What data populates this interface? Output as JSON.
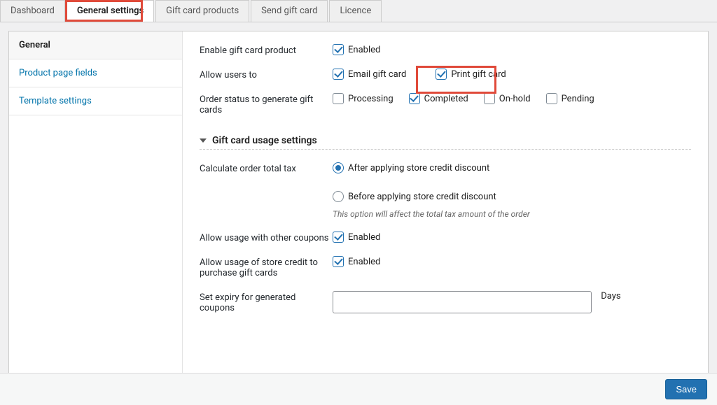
{
  "tabs": {
    "dashboard": "Dashboard",
    "general_settings": "General settings",
    "gift_card_products": "Gift card products",
    "send_gift_card": "Send gift card",
    "licence": "Licence"
  },
  "sidebar": {
    "general": "General",
    "product_page_fields": "Product page fields",
    "template_settings": "Template settings"
  },
  "fields": {
    "enable_gift_card_product": {
      "label": "Enable gift card product",
      "option": "Enabled",
      "checked": true
    },
    "allow_users_to": {
      "label": "Allow users to",
      "email": {
        "label": "Email gift card",
        "checked": true
      },
      "print": {
        "label": "Print gift card",
        "checked": true
      }
    },
    "order_status": {
      "label": "Order status to generate gift cards",
      "processing": {
        "label": "Processing",
        "checked": false
      },
      "completed": {
        "label": "Completed",
        "checked": true
      },
      "onhold": {
        "label": "On-hold",
        "checked": false
      },
      "pending": {
        "label": "Pending",
        "checked": false
      }
    }
  },
  "section_usage": {
    "title": "Gift card usage settings",
    "calc_tax": {
      "label": "Calculate order total tax",
      "after": "After applying store credit discount",
      "before": "Before applying store credit discount",
      "selected": "after",
      "hint": "This option will affect the total tax amount of the order"
    },
    "allow_with_coupons": {
      "label": "Allow usage with other coupons",
      "option": "Enabled",
      "checked": true
    },
    "allow_purchase_gc": {
      "label": "Allow usage of store credit to purchase gift cards",
      "option": "Enabled",
      "checked": true
    },
    "expiry": {
      "label": "Set expiry for generated coupons",
      "value": "",
      "unit": "Days"
    }
  },
  "save_label": "Save"
}
